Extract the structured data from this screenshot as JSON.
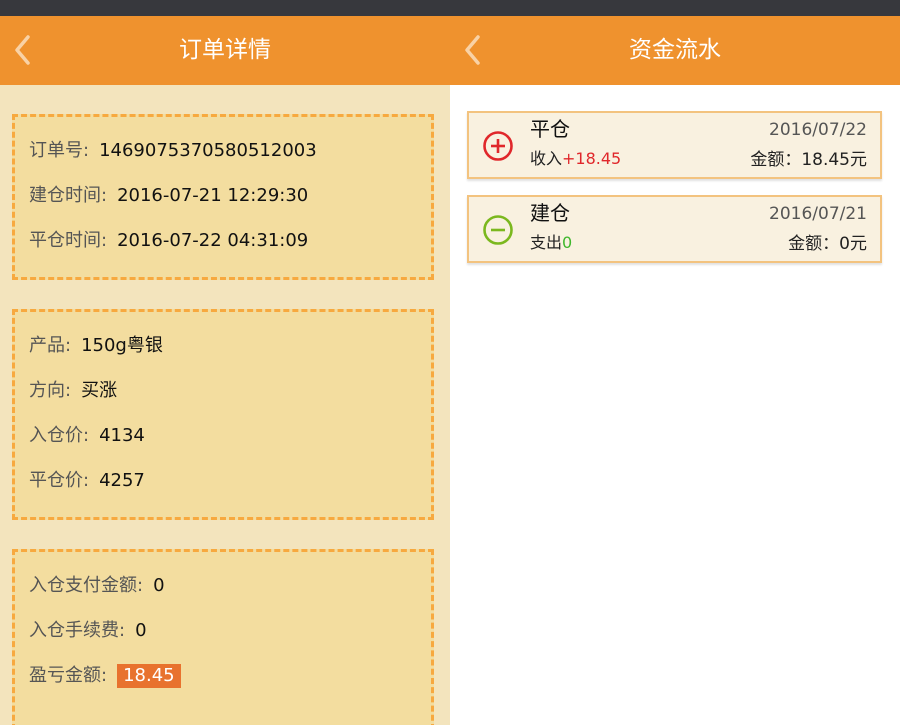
{
  "colors": {
    "header": "#ef922e",
    "box_fill": "#f3dd9f",
    "dash": "#f7a93f",
    "highlight": "#e8722e",
    "income": "#e0272b",
    "expense": "#3fb72c"
  },
  "order_detail": {
    "title": "订单详情",
    "back_icon": "chevron-left-icon",
    "section1": [
      {
        "label": "订单号:",
        "value": "1469075370580512003"
      },
      {
        "label": "建仓时间:",
        "value": "2016-07-21 12:29:30"
      },
      {
        "label": "平仓时间:",
        "value": "2016-07-22 04:31:09"
      }
    ],
    "section2": [
      {
        "label": "产品:",
        "value": "150g粤银"
      },
      {
        "label": "方向:",
        "value": "买涨"
      },
      {
        "label": "入仓价:",
        "value": "4134"
      },
      {
        "label": "平仓价:",
        "value": "4257"
      }
    ],
    "section3": [
      {
        "label": "入仓支付金额:",
        "value": "0"
      },
      {
        "label": "入仓手续费:",
        "value": "0"
      },
      {
        "label": "盈亏金额:",
        "value": "18.45"
      }
    ]
  },
  "fund_flow": {
    "title": "资金流水",
    "back_icon": "chevron-left-icon",
    "items": [
      {
        "icon": "plus-circle-icon",
        "title": "平仓",
        "type_label": "收入",
        "change": "+18.45",
        "date": "2016/07/22",
        "amount": "金额：18.45元"
      },
      {
        "icon": "minus-circle-icon",
        "title": "建仓",
        "type_label": "支出",
        "change": "0",
        "date": "2016/07/21",
        "amount": "金额：0元"
      }
    ]
  }
}
